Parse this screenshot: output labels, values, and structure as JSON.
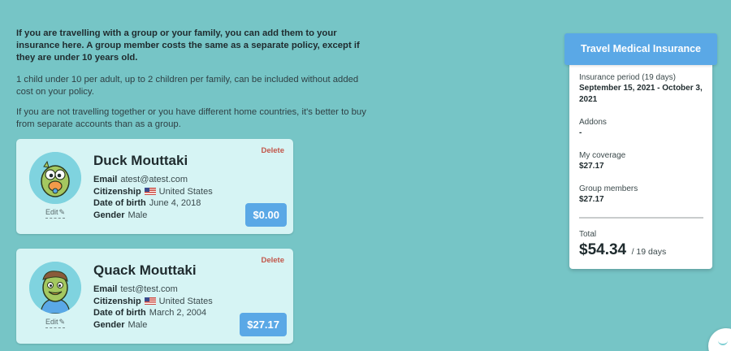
{
  "intro": {
    "lead": "If you are travelling with a group or your family, you can add them to your insurance here. A group member costs the same as a separate policy, except if they are under 10 years old.",
    "p1": "1 child under 10 per adult, up to 2 children per family, can be included without added cost on your policy.",
    "p2": "If you are not travelling together or you have different home countries, it's better to buy from separate accounts than as a group."
  },
  "members": [
    {
      "name": "Duck Mouttaki",
      "delete_label": "Delete",
      "edit_label": "Edit",
      "email_label": "Email",
      "email": "atest@atest.com",
      "citizenship_label": "Citizenship",
      "citizenship": "United States",
      "dob_label": "Date of birth",
      "dob": "June 4, 2018",
      "gender_label": "Gender",
      "gender": "Male",
      "price": "$0.00"
    },
    {
      "name": "Quack Mouttaki",
      "delete_label": "Delete",
      "edit_label": "Edit",
      "email_label": "Email",
      "email": "test@test.com",
      "citizenship_label": "Citizenship",
      "citizenship": "United States",
      "dob_label": "Date of birth",
      "dob": "March 2, 2004",
      "gender_label": "Gender",
      "gender": "Male",
      "price": "$27.17"
    }
  ],
  "summary": {
    "title": "Travel Medical Insurance",
    "period_label": "Insurance period (19 days)",
    "period_value": "September 15, 2021 - October 3, 2021",
    "addons_label": "Addons",
    "addons_value": "-",
    "coverage_label": "My coverage",
    "coverage_value": "$27.17",
    "group_label": "Group members",
    "group_value": "$27.17",
    "total_label": "Total",
    "total_amount": "$54.34",
    "total_days": "/ 19 days"
  },
  "colors": {
    "background": "#76c5c6",
    "card": "#d6f4f4",
    "accent": "#5aa8e6",
    "delete": "#c2564a"
  },
  "icons": [
    "pencil-icon",
    "us-flag-icon",
    "chat-icon"
  ]
}
